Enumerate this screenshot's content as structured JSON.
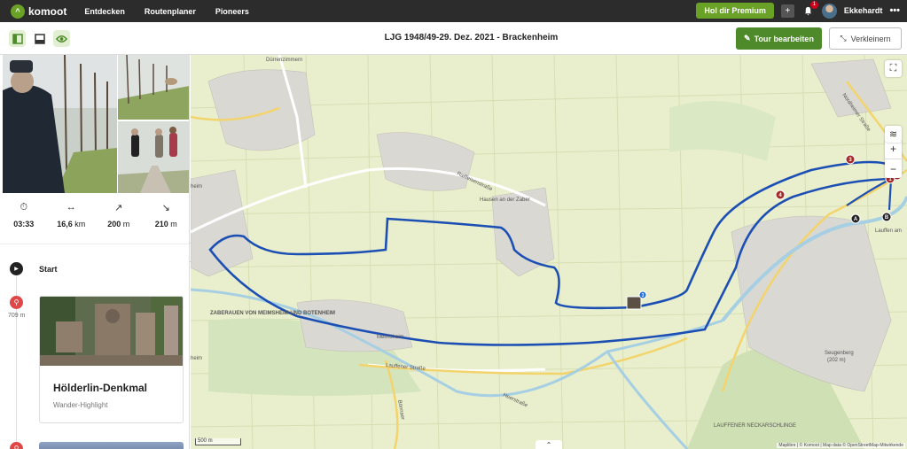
{
  "header": {
    "brand": "komoot",
    "nav": [
      "Entdecken",
      "Routenplaner",
      "Pioneers"
    ],
    "premium_label": "Hol dir Premium",
    "notification_count": "1",
    "username": "Ekkehardt"
  },
  "subheader": {
    "title": "LJG 1948/49-29. Dez. 2021 - Brackenheim",
    "edit_label": "Tour bearbeiten",
    "shrink_label": "Verkleinern"
  },
  "stats": [
    {
      "icon": "stopwatch-icon",
      "value": "03:33",
      "unit": ""
    },
    {
      "icon": "distance-arrows-icon",
      "value": "16,6",
      "unit": "km"
    },
    {
      "icon": "uphill-arrow-icon",
      "value": "200",
      "unit": "m"
    },
    {
      "icon": "downhill-arrow-icon",
      "value": "210",
      "unit": "m"
    }
  ],
  "timeline": {
    "start_label": "Start",
    "highlight_distance": "709 m",
    "highlight_title": "Hölderlin-Denkmal",
    "highlight_subtitle": "Wander-Highlight"
  },
  "map": {
    "labels": {
      "durrenzimmern": "Dürrenzimmern",
      "hausen": "Hausen an der Zaber",
      "raiffeisen": "Raiffeisenstraße",
      "zaberauen": "ZABERAUEN VON MEIMSHEIM UND BOTENHEIM",
      "meimsheim": "Meimsheim",
      "lauffener_str": "Lauffener Straße",
      "heerstrasse": "Heerstraße",
      "lauffen": "Lauffen am",
      "nordheimer": "Nordheimer Straße",
      "seugenberg": "Seugenberg",
      "seugenberg_elev": "(202 m)",
      "neckarschlinge": "LAUFFENER NECKARSCHLINGE",
      "heim_left": "heim",
      "heim_left2": "heim",
      "bonnaer": "Bönnaer"
    },
    "markers": [
      "1",
      "2",
      "3",
      "4",
      "A",
      "B",
      "3"
    ],
    "scale_label": "500 m",
    "attribution": "Maplibre | © Komoot | Map data © OpenStreetMap-Mitwirkende"
  },
  "colors": {
    "brand_green": "#6aa127",
    "route_blue": "#1c4fb4",
    "map_bg": "#e9efcc"
  }
}
